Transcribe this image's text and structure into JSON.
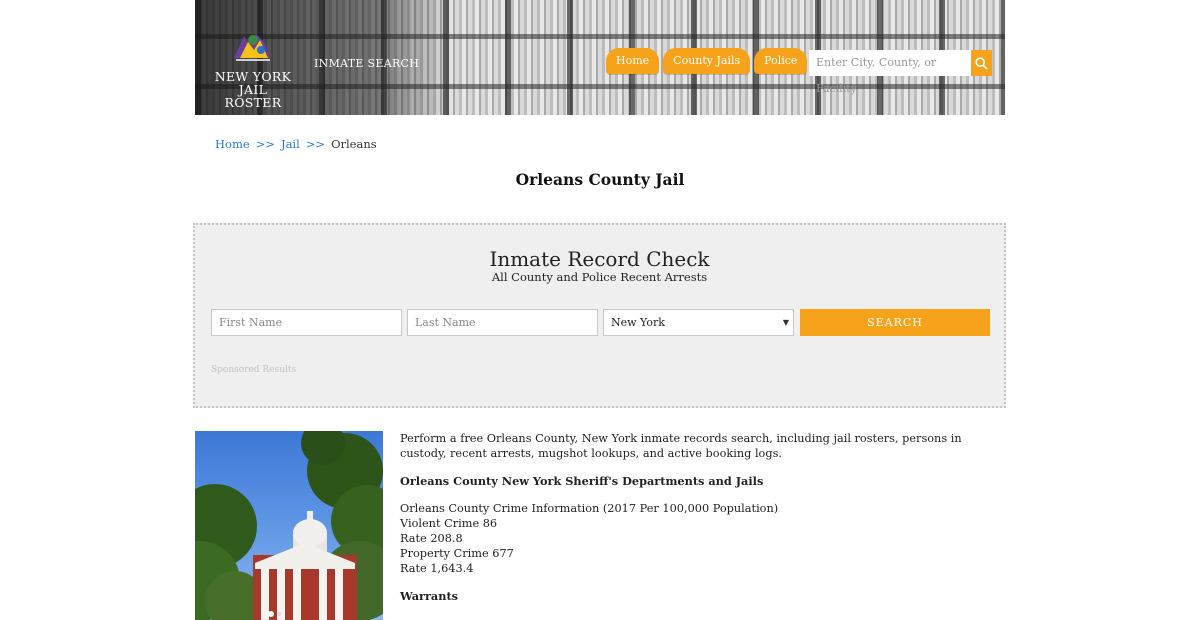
{
  "header": {
    "logo_line1": "NEW YORK",
    "logo_line2": "JAIL ROSTER",
    "inmate_search": "INMATE SEARCH",
    "nav": [
      "Home",
      "County Jails",
      "Police"
    ],
    "search_placeholder": "Enter City, County, or Facility",
    "accent_color": "#f6a21a"
  },
  "breadcrumb": {
    "home": "Home",
    "sep1": ">>",
    "jail": "Jail",
    "sep2": ">>",
    "current": "Orleans"
  },
  "page_title": "Orleans County Jail",
  "record_check": {
    "title": "Inmate Record Check",
    "subtitle": "All County and Police Recent Arrests",
    "first_name_placeholder": "First Name",
    "last_name_placeholder": "Last Name",
    "state_selected": "New York",
    "search_label": "SEARCH",
    "sponsored": "Sponsored Results"
  },
  "content": {
    "intro": "Perform a free Orleans County, New York inmate records search, including jail rosters, persons in custody, recent arrests, mugshot lookups, and active booking logs.",
    "departments_heading": "Orleans County New York Sheriff's Departments and Jails",
    "crime_heading": "Orleans County Crime Information (2017 Per 100,000 Population)",
    "violent_crime": "Violent Crime 86",
    "violent_rate": "Rate 208.8",
    "property_crime": "Property Crime 677",
    "property_rate": "Rate 1,643.4",
    "warrants_heading": "Warrants"
  }
}
